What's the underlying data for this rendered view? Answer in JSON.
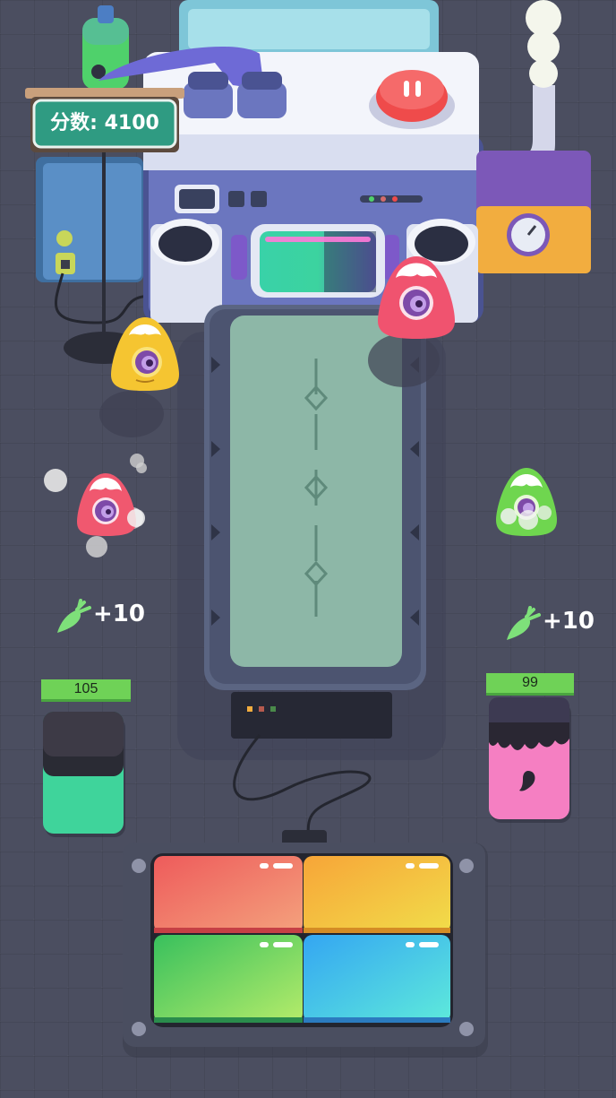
{
  "hud": {
    "score_label": "分数: 4100"
  },
  "bonuses": {
    "left": "+10",
    "right": "+10"
  },
  "jars": [
    {
      "id": "green-jar",
      "hp": "105",
      "color": "#3fd49b"
    },
    {
      "id": "pink-jar",
      "hp": "99",
      "color": "#f57fc2"
    }
  ],
  "colors": {
    "pad_red": "#ea5a5a",
    "pad_yellow": "#f3c93a",
    "pad_green": "#5bd16a",
    "pad_blue": "#42c7f0",
    "pause_button": "#ef4b4b",
    "belt": "#8db7a7"
  },
  "monsters": [
    "yellow-monster",
    "red-monster",
    "pink-monster",
    "green-monster"
  ]
}
